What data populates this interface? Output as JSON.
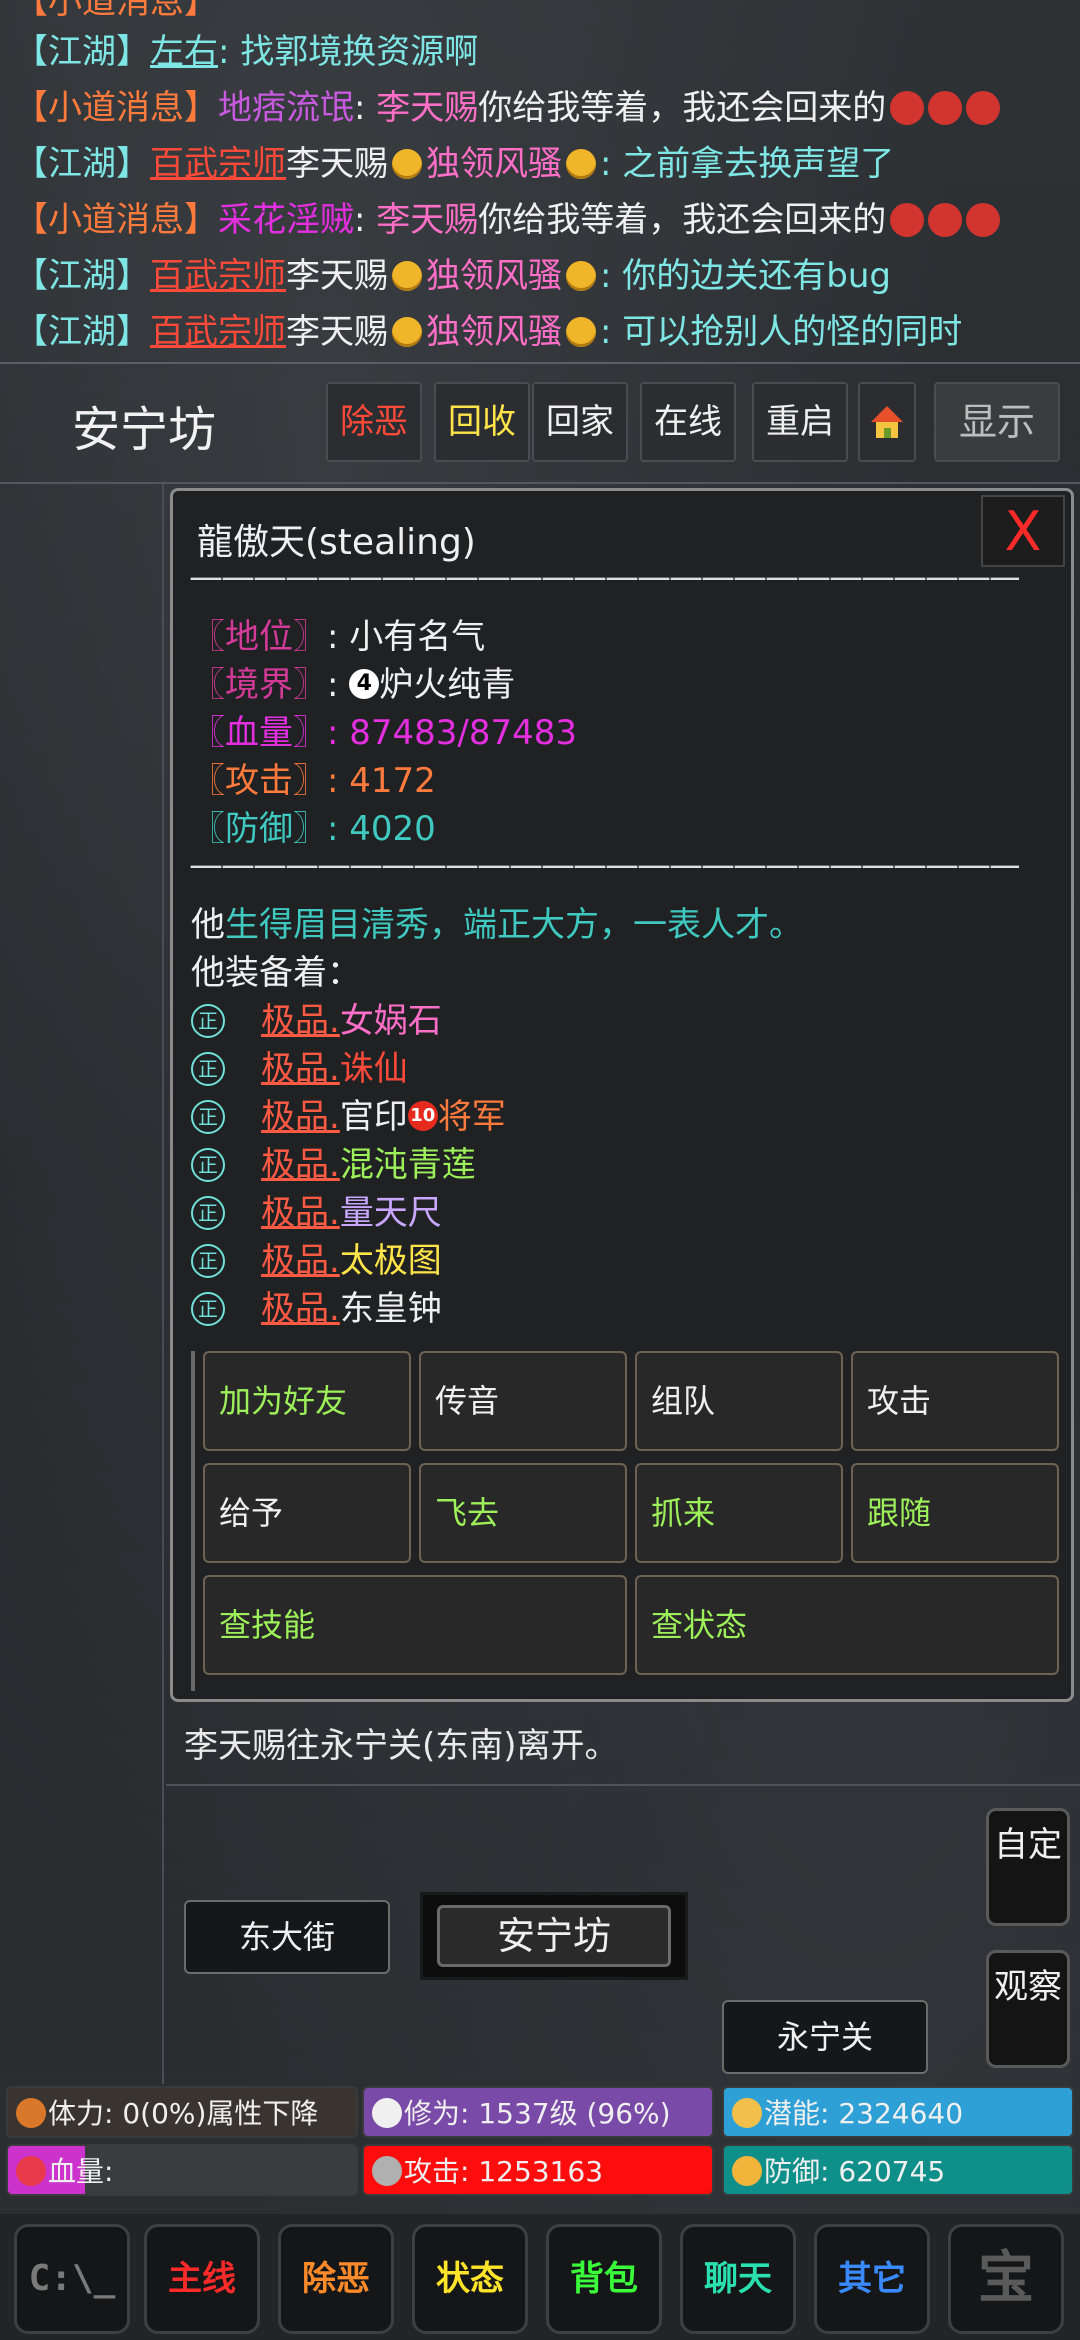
{
  "chat": {
    "line0": {
      "channel": "【江湖】",
      "user": "左右",
      "sep": ": ",
      "msg": "找郭境换资源啊"
    },
    "line1": {
      "channel": "【小道消息】",
      "user": "地痞流氓",
      "sep": ": ",
      "target": "李天赐",
      "msg": "你给我等着，我还会回来的"
    },
    "line2": {
      "channel": "【江湖】",
      "title": "百武宗师",
      "user": "李天赐",
      "faction": "独领风骚",
      "sep": ": ",
      "msg": "之前拿去换声望了"
    },
    "line3": {
      "channel": "【小道消息】",
      "user": "采花淫贼",
      "sep": ": ",
      "target": "李天赐",
      "msg": "你给我等着，我还会回来的"
    },
    "line4": {
      "channel": "【江湖】",
      "title": "百武宗师",
      "user": "李天赐",
      "faction": "独领风骚",
      "sep": ": ",
      "msg": "你的边关还有bug"
    },
    "line5": {
      "channel": "【江湖】",
      "title": "百武宗师",
      "user": "李天赐",
      "faction": "独领风骚",
      "sep": ": ",
      "msg": "可以抢别人的怪的同时"
    }
  },
  "header": {
    "location": "安宁坊",
    "buttons": [
      "除恶",
      "回收",
      "回家",
      "在线",
      "重启",
      "显示"
    ]
  },
  "panel": {
    "name": "龍傲天(stealing)",
    "close": "X",
    "dashes": "——————————————————————————",
    "attrs": {
      "status_label": "〖地位〗",
      "status_value": "小有名气",
      "realm_label": "〖境界〗",
      "realm_num": "4",
      "realm_value": "炉火纯青",
      "hp_label": "〖血量〗",
      "hp_value": "87483/87483",
      "atk_label": "〖攻击〗",
      "atk_value": "4172",
      "def_label": "〖防御〗",
      "def_value": "4020"
    },
    "desc_prefix": "他",
    "desc": "生得眉目清秀，端正大方，一表人才。",
    "equip_header": "他装备着：",
    "equip_mark": "正",
    "grade": "极品.",
    "equipment": [
      "女娲石",
      "诛仙",
      "官印",
      "混沌青莲",
      "量天尺",
      "太极图",
      "东皇钟"
    ],
    "seal_num": "10",
    "seal_suffix": "将军",
    "actions": [
      "加为好友",
      "传音",
      "组队",
      "攻击",
      "给予",
      "飞去",
      "抓来",
      "跟随",
      "查技能",
      "查状态"
    ]
  },
  "event": "李天赐往永宁关(东南)离开。",
  "map": {
    "west": "东大街",
    "current": "安宁坊",
    "southeast": "永宁关"
  },
  "side_buttons": {
    "custom": "自定",
    "observe": "观察"
  },
  "stats": {
    "stamina": "体力: 0(0%)属性下降",
    "cultivation": "修为: 1537级 (96%)",
    "potential": "潜能: 2324640",
    "hp": "血量:",
    "attack": "攻击: 1253163",
    "defense": "防御: 620745",
    "hp_fill": 0.22
  },
  "bottom_nav": [
    "主线",
    "除恶",
    "状态",
    "背包",
    "聊天",
    "其它"
  ],
  "colors": {
    "accent_red": "#ff2a2a",
    "cyan": "#7fe6e6",
    "orange": "#ff7a3d"
  }
}
